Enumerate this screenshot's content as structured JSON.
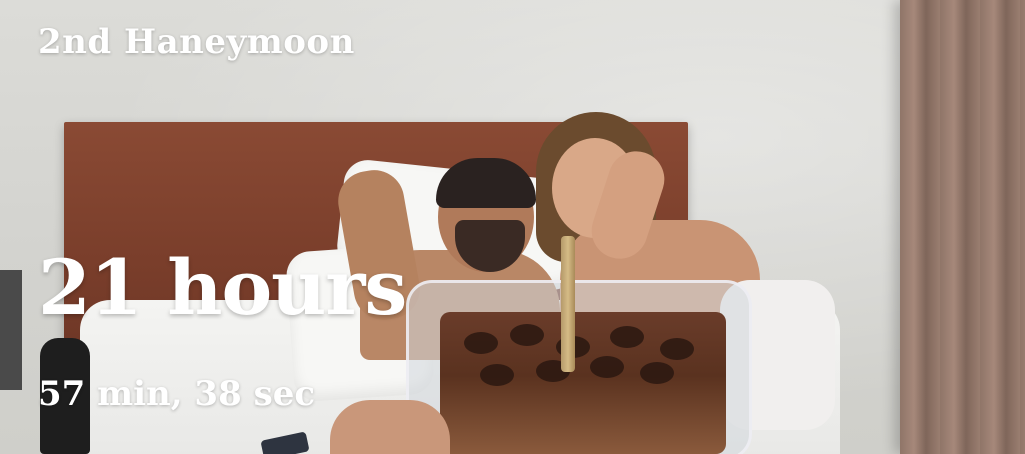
{
  "overlay": {
    "title": "2nd Haneymoon",
    "hours": "21 hours",
    "remainder": "57 min, 38 sec"
  },
  "photo": {
    "subject": "couple-in-bed-photo",
    "colors": {
      "headboard": "#7a3e2b",
      "wall": "#d9d9d4",
      "text": "#ffffff"
    }
  }
}
